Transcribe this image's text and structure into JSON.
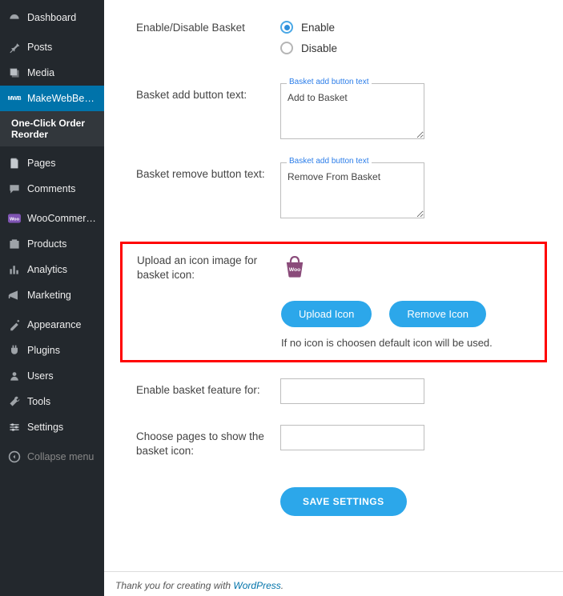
{
  "sidebar": {
    "dashboard": "Dashboard",
    "posts": "Posts",
    "media": "Media",
    "mwb": "MakeWebBetter",
    "mwb_sub": "One-Click Order Reorder",
    "pages": "Pages",
    "comments": "Comments",
    "woocommerce": "WooCommerce",
    "products": "Products",
    "analytics": "Analytics",
    "marketing": "Marketing",
    "appearance": "Appearance",
    "plugins": "Plugins",
    "users": "Users",
    "tools": "Tools",
    "settings": "Settings",
    "collapse": "Collapse menu"
  },
  "form": {
    "enable_label": "Enable/Disable Basket",
    "opt_enable": "Enable",
    "opt_disable": "Disable",
    "add_text_label": "Basket add button text:",
    "add_legend": "Basket add button text",
    "add_value": "Add to Basket",
    "remove_text_label": "Basket remove button text:",
    "remove_legend": "Basket add button text",
    "remove_value": "Remove From Basket",
    "upload_label": "Upload an icon image for basket icon:",
    "upload_btn": "Upload Icon",
    "remove_btn": "Remove Icon",
    "upload_hint": "If no icon is choosen default icon will be used.",
    "enable_for_label": "Enable basket feature for:",
    "enable_for_value": "",
    "choose_pages_label": "Choose pages to show the basket icon:",
    "choose_pages_value": "",
    "save": "SAVE SETTINGS"
  },
  "footer": {
    "text": "Thank you for creating with ",
    "link": "WordPress",
    "suffix": "."
  }
}
